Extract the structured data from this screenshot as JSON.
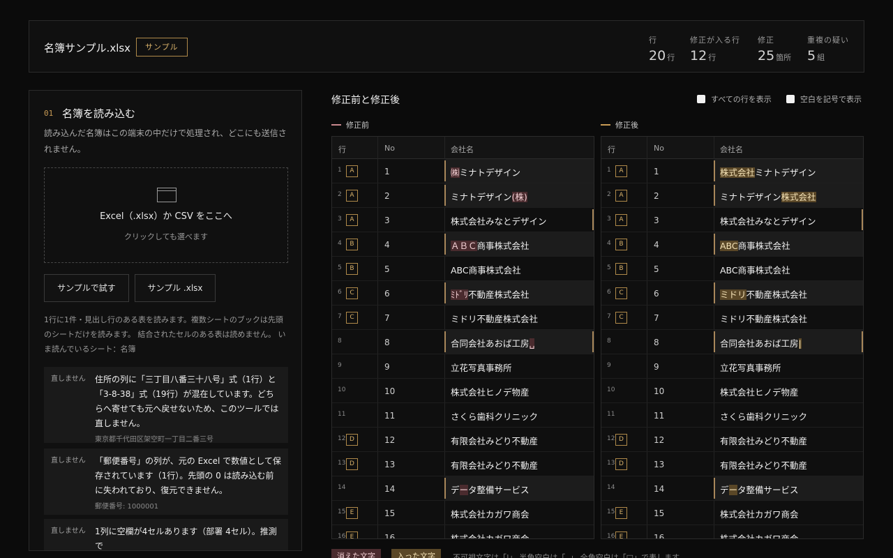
{
  "header": {
    "file_name": "名簿サンプル.xlsx",
    "tag": "サンプル",
    "stats": [
      {
        "label": "行",
        "value": "20",
        "unit": "行"
      },
      {
        "label": "修正が入る行",
        "value": "12",
        "unit": "行"
      },
      {
        "label": "修正",
        "value": "25",
        "unit": "箇所"
      },
      {
        "label": "重複の疑い",
        "value": "5",
        "unit": "組"
      }
    ]
  },
  "load": {
    "step": "01",
    "title": "名簿を読み込む",
    "desc": "読み込んだ名簿はこの端末の中だけで処理され、どこにも送信されません。",
    "drop_title": "Excel（.xlsx）か CSV をここへ",
    "drop_sub": "クリックしても選べます",
    "btn_sample": "サンプルで試す",
    "btn_sample_file": "サンプル .xlsx",
    "note": "1行に1件・見出し行のある表を読みます。複数シートのブックは先頭のシートだけを読みます。 結合されたセルのある表は読めません。 いま読んでいるシート：名簿",
    "warnings": [
      {
        "label": "直しません",
        "text": "住所の列に「三丁目八番三十八号」式（1行）と「3-8-38」式（19行）が混在しています。どちらへ寄せても元へ戻せないため、このツールでは直しません。",
        "detail": "東京都千代田区架空町一丁目二番三号"
      },
      {
        "label": "直しません",
        "text": "「郵便番号」の列が、元の Excel で数値として保存されています（1行）。先頭の 0 は読み込む前に失われており、復元できません。",
        "detail": "郵便番号: 1000001"
      },
      {
        "label": "直しません",
        "text": "1列に空欄が4セルあります（部署 4セル）。推測で",
        "detail": ""
      }
    ]
  },
  "compare": {
    "title": "修正前と修正後",
    "show_all_rows": "すべての行を表示",
    "show_spaces": "空白を記号で表示",
    "before_label": "修正前",
    "after_label": "修正後",
    "col_row": "行",
    "col_no": "No",
    "col_company": "会社名",
    "colors": {
      "deleted": "#4a2b2e",
      "inserted": "#5a4727",
      "accent": "#b08a4a"
    }
  },
  "rows": [
    {
      "row": "1",
      "group": "A",
      "no": "1",
      "before": [
        [
          "㈱",
          "del"
        ],
        [
          "ミナトデザイン",
          ""
        ]
      ],
      "after": [
        [
          "株式会社",
          "ins"
        ],
        [
          "ミナトデザイン",
          ""
        ]
      ],
      "changed": true
    },
    {
      "row": "2",
      "group": "A",
      "no": "2",
      "before": [
        [
          "ミナトデザイン",
          ""
        ],
        [
          "(株)",
          "del"
        ]
      ],
      "after": [
        [
          "ミナトデザイン",
          ""
        ],
        [
          "株式会社",
          "ins"
        ]
      ],
      "changed": true
    },
    {
      "row": "3",
      "group": "A",
      "no": "3",
      "before": [
        [
          "株式会社みなとデザイン",
          ""
        ]
      ],
      "after": [
        [
          "株式会社みなとデザイン",
          ""
        ]
      ],
      "changed": false,
      "right_mark": true
    },
    {
      "row": "4",
      "group": "B",
      "no": "4",
      "before": [
        [
          "ＡＢＣ",
          "del"
        ],
        [
          "商事株式会社",
          ""
        ]
      ],
      "after": [
        [
          "ABC",
          "ins"
        ],
        [
          "商事株式会社",
          ""
        ]
      ],
      "changed": true
    },
    {
      "row": "5",
      "group": "B",
      "no": "5",
      "before": [
        [
          "ABC商事株式会社",
          ""
        ]
      ],
      "after": [
        [
          "ABC商事株式会社",
          ""
        ]
      ],
      "changed": false
    },
    {
      "row": "6",
      "group": "C",
      "no": "6",
      "before": [
        [
          "ﾐﾄﾞﾘ",
          "del"
        ],
        [
          "不動産株式会社",
          ""
        ]
      ],
      "after": [
        [
          "ミドリ",
          "ins"
        ],
        [
          "不動産株式会社",
          ""
        ]
      ],
      "changed": true
    },
    {
      "row": "7",
      "group": "C",
      "no": "7",
      "before": [
        [
          "ミドリ不動産株式会社",
          ""
        ]
      ],
      "after": [
        [
          "ミドリ不動産株式会社",
          ""
        ]
      ],
      "changed": false
    },
    {
      "row": "8",
      "group": "",
      "no": "8",
      "before": [
        [
          "合同会社あおば工房",
          ""
        ],
        [
          "␣",
          "del"
        ]
      ],
      "after": [
        [
          "合同会社あおば工房",
          ""
        ],
        [
          "|",
          "ins"
        ]
      ],
      "changed": true,
      "right_mark": true
    },
    {
      "row": "9",
      "group": "",
      "no": "9",
      "before": [
        [
          "立花写真事務所",
          ""
        ]
      ],
      "after": [
        [
          "立花写真事務所",
          ""
        ]
      ],
      "changed": false
    },
    {
      "row": "10",
      "group": "",
      "no": "10",
      "before": [
        [
          "株式会社ヒノデ物産",
          ""
        ]
      ],
      "after": [
        [
          "株式会社ヒノデ物産",
          ""
        ]
      ],
      "changed": false
    },
    {
      "row": "11",
      "group": "",
      "no": "11",
      "before": [
        [
          "さくら歯科クリニック",
          ""
        ]
      ],
      "after": [
        [
          "さくら歯科クリニック",
          ""
        ]
      ],
      "changed": false
    },
    {
      "row": "12",
      "group": "D",
      "no": "12",
      "before": [
        [
          "有限会社みどり不動産",
          ""
        ]
      ],
      "after": [
        [
          "有限会社みどり不動産",
          ""
        ]
      ],
      "changed": false
    },
    {
      "row": "13",
      "group": "D",
      "no": "13",
      "before": [
        [
          "有限会社みどり不動産",
          ""
        ]
      ],
      "after": [
        [
          "有限会社みどり不動産",
          ""
        ]
      ],
      "changed": false
    },
    {
      "row": "14",
      "group": "",
      "no": "14",
      "before": [
        [
          "デ",
          ""
        ],
        [
          "ー",
          "del"
        ],
        [
          "タ整備サービス",
          ""
        ]
      ],
      "after": [
        [
          "デ",
          ""
        ],
        [
          "ー",
          "ins"
        ],
        [
          "タ整備サービス",
          ""
        ]
      ],
      "changed": true
    },
    {
      "row": "15",
      "group": "E",
      "no": "15",
      "before": [
        [
          "株式会社カガワ商会",
          ""
        ]
      ],
      "after": [
        [
          "株式会社カガワ商会",
          ""
        ]
      ],
      "changed": false
    },
    {
      "row": "16",
      "group": "E",
      "no": "16",
      "before": [
        [
          "株式会社カガワ商会",
          ""
        ]
      ],
      "after": [
        [
          "株式会社カガワ商会",
          ""
        ]
      ],
      "changed": false
    }
  ],
  "legend": {
    "deleted": "消えた文字",
    "inserted": "入った文字",
    "note": "不可視文字は「|」 半角空白は「␣」 全角空白は「□」で表します"
  }
}
